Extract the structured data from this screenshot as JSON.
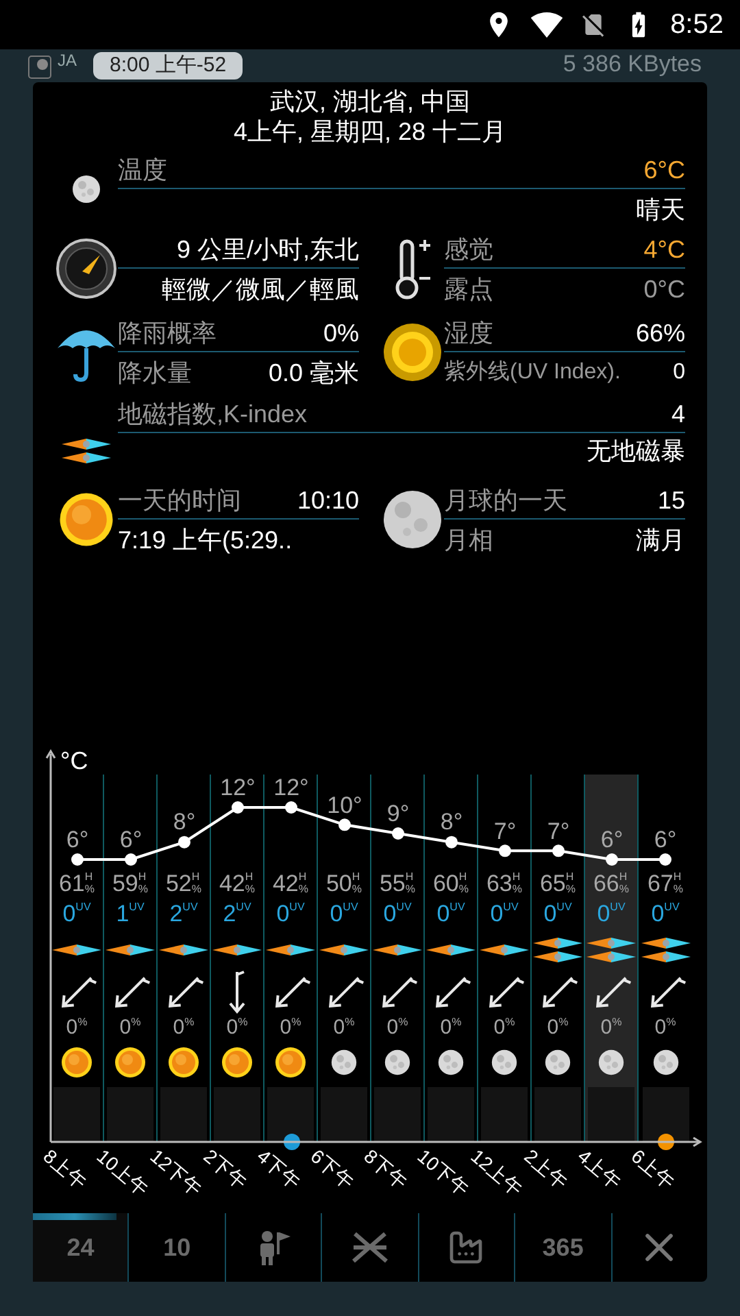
{
  "status_bar": {
    "time": "8:52"
  },
  "map_header": {
    "layer": "JA",
    "time_chip": "8:00 上午-52",
    "cache": "5 386 KBytes"
  },
  "location": "武汉, 湖北省, 中国",
  "datetime": "4上午, 星期四, 28 十二月",
  "temperature": {
    "label": "温度",
    "value": "6°C",
    "condition": "晴天"
  },
  "wind": {
    "speed": "9 公里/小时,东北",
    "description": "輕微／微風／輕風"
  },
  "feels_like": {
    "label": "感觉",
    "value": "4°C"
  },
  "dew_point": {
    "label": "露点",
    "value": "0°C"
  },
  "rain_chance": {
    "label": "降雨概率",
    "value": "0%"
  },
  "precipitation": {
    "label": "降水量",
    "value": "0.0 毫米"
  },
  "humidity": {
    "label": "湿度",
    "value": "66%"
  },
  "uv_index": {
    "label": "紫外线(UV Index).",
    "value": "0"
  },
  "k_index": {
    "label": "地磁指数,K-index",
    "value": "4",
    "status": "无地磁暴"
  },
  "daylight": {
    "label": "一天的时间",
    "value": "10:10",
    "sunrise": "7:19 上午(5:29.."
  },
  "moon": {
    "label": "月球的一天",
    "value": "15",
    "phase_label": "月相",
    "phase": "满月"
  },
  "temperature_unit": "°C",
  "times": [
    "8上午",
    "10上午",
    "12下午",
    "2下午",
    "4下午",
    "6下午",
    "8下午",
    "10下午",
    "12上午",
    "2上午",
    "4上午",
    "6上午"
  ],
  "chart_data": {
    "type": "line",
    "series": [
      {
        "color": "#ffffff",
        "marker": "circle",
        "values": [
          6,
          6,
          8,
          12,
          12,
          10,
          9,
          8,
          7,
          7,
          6,
          6
        ],
        "value_labels": [
          "6°",
          "6°",
          "8°",
          "12°",
          "12°",
          "10°",
          "9°",
          "8°",
          "7°",
          "7°",
          "6°",
          "6°"
        ]
      }
    ]
  },
  "hours": [
    {
      "humidity": "61",
      "humidity_mark": "H",
      "humidity_unit": "%",
      "uv": "0",
      "uv_unit": "UV",
      "rain": "0",
      "rain_unit": "%",
      "sky": {
        "kind": "sun"
      },
      "kp": {
        "kind": "single"
      },
      "wind": {
        "kind": "sw"
      },
      "selected": false
    },
    {
      "humidity": "59",
      "humidity_mark": "H",
      "humidity_unit": "%",
      "uv": "1",
      "uv_unit": "UV",
      "rain": "0",
      "rain_unit": "%",
      "sky": {
        "kind": "sun"
      },
      "kp": {
        "kind": "single"
      },
      "wind": {
        "kind": "sw"
      },
      "selected": false
    },
    {
      "humidity": "52",
      "humidity_mark": "H",
      "humidity_unit": "%",
      "uv": "2",
      "uv_unit": "UV",
      "rain": "0",
      "rain_unit": "%",
      "sky": {
        "kind": "sun"
      },
      "kp": {
        "kind": "single"
      },
      "wind": {
        "kind": "sw"
      },
      "selected": false
    },
    {
      "humidity": "42",
      "humidity_mark": "H",
      "humidity_unit": "%",
      "uv": "2",
      "uv_unit": "UV",
      "rain": "0",
      "rain_unit": "%",
      "sky": {
        "kind": "sun"
      },
      "kp": {
        "kind": "single"
      },
      "wind": {
        "kind": "s"
      },
      "selected": false
    },
    {
      "humidity": "42",
      "humidity_mark": "H",
      "humidity_unit": "%",
      "uv": "0",
      "uv_unit": "UV",
      "rain": "0",
      "rain_unit": "%",
      "sky": {
        "kind": "sun"
      },
      "kp": {
        "kind": "single"
      },
      "wind": {
        "kind": "sw"
      },
      "selected": false,
      "color": "#1e9bd7"
    },
    {
      "humidity": "50",
      "humidity_mark": "H",
      "humidity_unit": "%",
      "uv": "0",
      "uv_unit": "UV",
      "rain": "0",
      "rain_unit": "%",
      "sky": {
        "kind": "moon"
      },
      "kp": {
        "kind": "single"
      },
      "wind": {
        "kind": "sw"
      },
      "selected": false
    },
    {
      "humidity": "55",
      "humidity_mark": "H",
      "humidity_unit": "%",
      "uv": "0",
      "uv_unit": "UV",
      "rain": "0",
      "rain_unit": "%",
      "sky": {
        "kind": "moon"
      },
      "kp": {
        "kind": "single"
      },
      "wind": {
        "kind": "sw"
      },
      "selected": false
    },
    {
      "humidity": "60",
      "humidity_mark": "H",
      "humidity_unit": "%",
      "uv": "0",
      "uv_unit": "UV",
      "rain": "0",
      "rain_unit": "%",
      "sky": {
        "kind": "moon"
      },
      "kp": {
        "kind": "single"
      },
      "wind": {
        "kind": "sw"
      },
      "selected": false
    },
    {
      "humidity": "63",
      "humidity_mark": "H",
      "humidity_unit": "%",
      "uv": "0",
      "uv_unit": "UV",
      "rain": "0",
      "rain_unit": "%",
      "sky": {
        "kind": "moon"
      },
      "kp": {
        "kind": "single"
      },
      "wind": {
        "kind": "sw"
      },
      "selected": false
    },
    {
      "humidity": "65",
      "humidity_mark": "H",
      "humidity_unit": "%",
      "uv": "0",
      "uv_unit": "UV",
      "rain": "0",
      "rain_unit": "%",
      "sky": {
        "kind": "moon"
      },
      "kp": {
        "kind": "double"
      },
      "wind": {
        "kind": "sw"
      },
      "selected": false
    },
    {
      "humidity": "66",
      "humidity_mark": "H",
      "humidity_unit": "%",
      "uv": "0",
      "uv_unit": "UV",
      "rain": "0",
      "rain_unit": "%",
      "sky": {
        "kind": "moon"
      },
      "kp": {
        "kind": "double"
      },
      "wind": {
        "kind": "sw"
      },
      "selected": true
    },
    {
      "humidity": "67",
      "humidity_mark": "H",
      "humidity_unit": "%",
      "uv": "0",
      "uv_unit": "UV",
      "rain": "0",
      "rain_unit": "%",
      "sky": {
        "kind": "moon"
      },
      "kp": {
        "kind": "double"
      },
      "wind": {
        "kind": "sw"
      },
      "selected": false,
      "color": "#f39200"
    }
  ],
  "tabs": [
    {
      "kind": "text",
      "label": "24",
      "selected": true
    },
    {
      "kind": "text",
      "label": "10",
      "selected": false
    },
    {
      "kind": "person",
      "selected": false
    },
    {
      "kind": "tools",
      "selected": false
    },
    {
      "kind": "factory",
      "selected": false
    },
    {
      "kind": "text",
      "label": "365",
      "selected": false
    },
    {
      "kind": "close",
      "selected": false
    }
  ]
}
